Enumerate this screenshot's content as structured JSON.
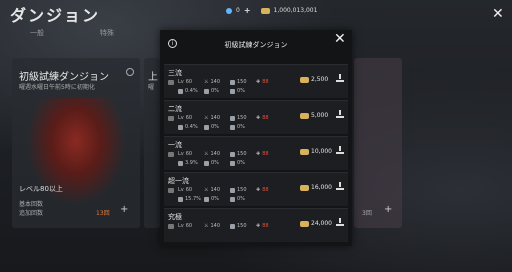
{
  "header": {
    "title": "ダンジョン",
    "energy": "0",
    "plus": "+",
    "gold": "1,000,013,001",
    "close": "✕"
  },
  "tabs": [
    "一般",
    "特殊"
  ],
  "card1": {
    "title": "初級試練ダンジョン",
    "sub": "曜週水曜日午前5時に初期化",
    "level": "レベル80以上",
    "foot1": "基本回数",
    "foot2": "追加回数",
    "count": "13回",
    "plus": "+"
  },
  "card2": {
    "title": "上",
    "sub": "曜"
  },
  "card3": {
    "count": "3回",
    "plus": "+"
  },
  "modal": {
    "info": "i",
    "title": "初級試練ダンジョン",
    "close": "✕",
    "rows": [
      {
        "name": "三流",
        "lv": "60",
        "atk": "140",
        "def": "150",
        "red": "88",
        "r1": "0.4%",
        "r2": "0%",
        "r3": "0%",
        "price": "2,500"
      },
      {
        "name": "二流",
        "lv": "60",
        "atk": "140",
        "def": "150",
        "red": "88",
        "r1": "0.4%",
        "r2": "0%",
        "r3": "0%",
        "price": "5,000"
      },
      {
        "name": "一流",
        "lv": "60",
        "atk": "140",
        "def": "150",
        "red": "88",
        "r1": "3.9%",
        "r2": "0%",
        "r3": "0%",
        "price": "10,000"
      },
      {
        "name": "超一流",
        "lv": "60",
        "atk": "140",
        "def": "150",
        "red": "88",
        "r1": "15.7%",
        "r2": "0%",
        "r3": "0%",
        "price": "16,000"
      },
      {
        "name": "究極",
        "lv": "60",
        "atk": "140",
        "def": "150",
        "red": "88",
        "r1": "",
        "r2": "",
        "r3": "",
        "price": "24,000"
      }
    ]
  }
}
